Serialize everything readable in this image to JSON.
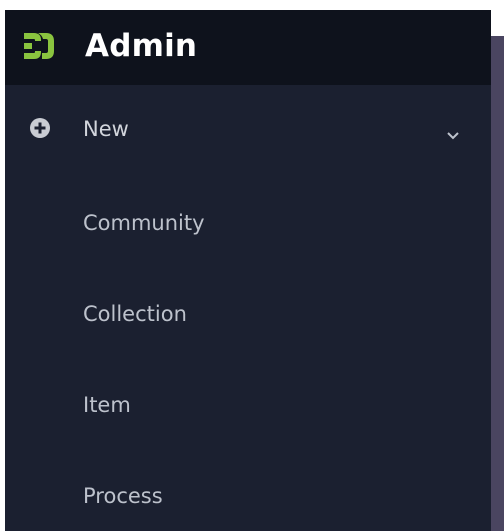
{
  "header": {
    "title": "Admin",
    "logo_icon": "dspace-logo-icon",
    "logo_color": "#8ac43f"
  },
  "menu": {
    "items": [
      {
        "label": "New",
        "icon": "plus-circle-icon",
        "expandable": true,
        "expand_icon": "chevron-down-icon"
      },
      {
        "label": "Community"
      },
      {
        "label": "Collection"
      },
      {
        "label": "Item"
      },
      {
        "label": "Process"
      }
    ]
  },
  "colors": {
    "sidebar_bg": "#1b2030",
    "header_bg": "#0e121c",
    "text": "#bdc2cc",
    "title": "#ffffff",
    "accent": "#8ac43f"
  }
}
